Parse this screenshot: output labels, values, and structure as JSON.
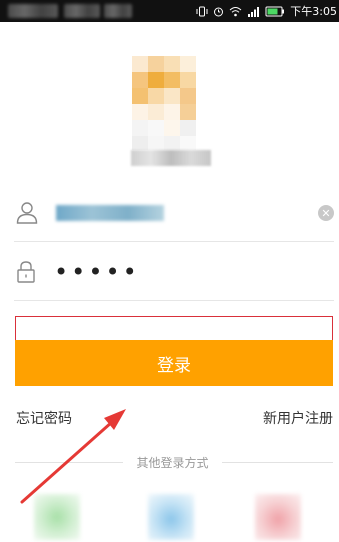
{
  "status_bar": {
    "time": "下午3:05",
    "icons": [
      "vibrate-icon",
      "alarm-icon",
      "wifi-icon",
      "signal-icon",
      "battery-icon"
    ]
  },
  "login_form": {
    "username_value": "",
    "password_value": "•••••",
    "login_label": "登录",
    "forgot_password": "忘记密码",
    "register": "新用户注册"
  },
  "other_login": {
    "label": "其他登录方式",
    "providers": [
      "green-login-icon",
      "blue-login-icon",
      "red-login-icon"
    ]
  },
  "colors": {
    "accent": "#ffa100",
    "highlight_border": "#d9303a",
    "arrow": "#e53935"
  }
}
